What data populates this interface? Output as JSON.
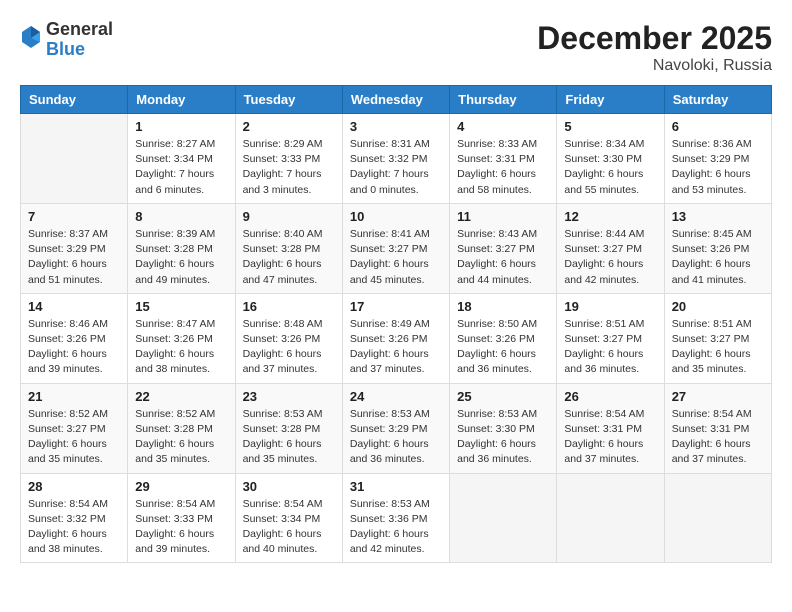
{
  "logo": {
    "general": "General",
    "blue": "Blue"
  },
  "title": "December 2025",
  "subtitle": "Navoloki, Russia",
  "days_header": [
    "Sunday",
    "Monday",
    "Tuesday",
    "Wednesday",
    "Thursday",
    "Friday",
    "Saturday"
  ],
  "weeks": [
    [
      {
        "day": "",
        "info": ""
      },
      {
        "day": "1",
        "info": "Sunrise: 8:27 AM\nSunset: 3:34 PM\nDaylight: 7 hours\nand 6 minutes."
      },
      {
        "day": "2",
        "info": "Sunrise: 8:29 AM\nSunset: 3:33 PM\nDaylight: 7 hours\nand 3 minutes."
      },
      {
        "day": "3",
        "info": "Sunrise: 8:31 AM\nSunset: 3:32 PM\nDaylight: 7 hours\nand 0 minutes."
      },
      {
        "day": "4",
        "info": "Sunrise: 8:33 AM\nSunset: 3:31 PM\nDaylight: 6 hours\nand 58 minutes."
      },
      {
        "day": "5",
        "info": "Sunrise: 8:34 AM\nSunset: 3:30 PM\nDaylight: 6 hours\nand 55 minutes."
      },
      {
        "day": "6",
        "info": "Sunrise: 8:36 AM\nSunset: 3:29 PM\nDaylight: 6 hours\nand 53 minutes."
      }
    ],
    [
      {
        "day": "7",
        "info": "Sunrise: 8:37 AM\nSunset: 3:29 PM\nDaylight: 6 hours\nand 51 minutes."
      },
      {
        "day": "8",
        "info": "Sunrise: 8:39 AM\nSunset: 3:28 PM\nDaylight: 6 hours\nand 49 minutes."
      },
      {
        "day": "9",
        "info": "Sunrise: 8:40 AM\nSunset: 3:28 PM\nDaylight: 6 hours\nand 47 minutes."
      },
      {
        "day": "10",
        "info": "Sunrise: 8:41 AM\nSunset: 3:27 PM\nDaylight: 6 hours\nand 45 minutes."
      },
      {
        "day": "11",
        "info": "Sunrise: 8:43 AM\nSunset: 3:27 PM\nDaylight: 6 hours\nand 44 minutes."
      },
      {
        "day": "12",
        "info": "Sunrise: 8:44 AM\nSunset: 3:27 PM\nDaylight: 6 hours\nand 42 minutes."
      },
      {
        "day": "13",
        "info": "Sunrise: 8:45 AM\nSunset: 3:26 PM\nDaylight: 6 hours\nand 41 minutes."
      }
    ],
    [
      {
        "day": "14",
        "info": "Sunrise: 8:46 AM\nSunset: 3:26 PM\nDaylight: 6 hours\nand 39 minutes."
      },
      {
        "day": "15",
        "info": "Sunrise: 8:47 AM\nSunset: 3:26 PM\nDaylight: 6 hours\nand 38 minutes."
      },
      {
        "day": "16",
        "info": "Sunrise: 8:48 AM\nSunset: 3:26 PM\nDaylight: 6 hours\nand 37 minutes."
      },
      {
        "day": "17",
        "info": "Sunrise: 8:49 AM\nSunset: 3:26 PM\nDaylight: 6 hours\nand 37 minutes."
      },
      {
        "day": "18",
        "info": "Sunrise: 8:50 AM\nSunset: 3:26 PM\nDaylight: 6 hours\nand 36 minutes."
      },
      {
        "day": "19",
        "info": "Sunrise: 8:51 AM\nSunset: 3:27 PM\nDaylight: 6 hours\nand 36 minutes."
      },
      {
        "day": "20",
        "info": "Sunrise: 8:51 AM\nSunset: 3:27 PM\nDaylight: 6 hours\nand 35 minutes."
      }
    ],
    [
      {
        "day": "21",
        "info": "Sunrise: 8:52 AM\nSunset: 3:27 PM\nDaylight: 6 hours\nand 35 minutes."
      },
      {
        "day": "22",
        "info": "Sunrise: 8:52 AM\nSunset: 3:28 PM\nDaylight: 6 hours\nand 35 minutes."
      },
      {
        "day": "23",
        "info": "Sunrise: 8:53 AM\nSunset: 3:28 PM\nDaylight: 6 hours\nand 35 minutes."
      },
      {
        "day": "24",
        "info": "Sunrise: 8:53 AM\nSunset: 3:29 PM\nDaylight: 6 hours\nand 36 minutes."
      },
      {
        "day": "25",
        "info": "Sunrise: 8:53 AM\nSunset: 3:30 PM\nDaylight: 6 hours\nand 36 minutes."
      },
      {
        "day": "26",
        "info": "Sunrise: 8:54 AM\nSunset: 3:31 PM\nDaylight: 6 hours\nand 37 minutes."
      },
      {
        "day": "27",
        "info": "Sunrise: 8:54 AM\nSunset: 3:31 PM\nDaylight: 6 hours\nand 37 minutes."
      }
    ],
    [
      {
        "day": "28",
        "info": "Sunrise: 8:54 AM\nSunset: 3:32 PM\nDaylight: 6 hours\nand 38 minutes."
      },
      {
        "day": "29",
        "info": "Sunrise: 8:54 AM\nSunset: 3:33 PM\nDaylight: 6 hours\nand 39 minutes."
      },
      {
        "day": "30",
        "info": "Sunrise: 8:54 AM\nSunset: 3:34 PM\nDaylight: 6 hours\nand 40 minutes."
      },
      {
        "day": "31",
        "info": "Sunrise: 8:53 AM\nSunset: 3:36 PM\nDaylight: 6 hours\nand 42 minutes."
      },
      {
        "day": "",
        "info": ""
      },
      {
        "day": "",
        "info": ""
      },
      {
        "day": "",
        "info": ""
      }
    ]
  ]
}
